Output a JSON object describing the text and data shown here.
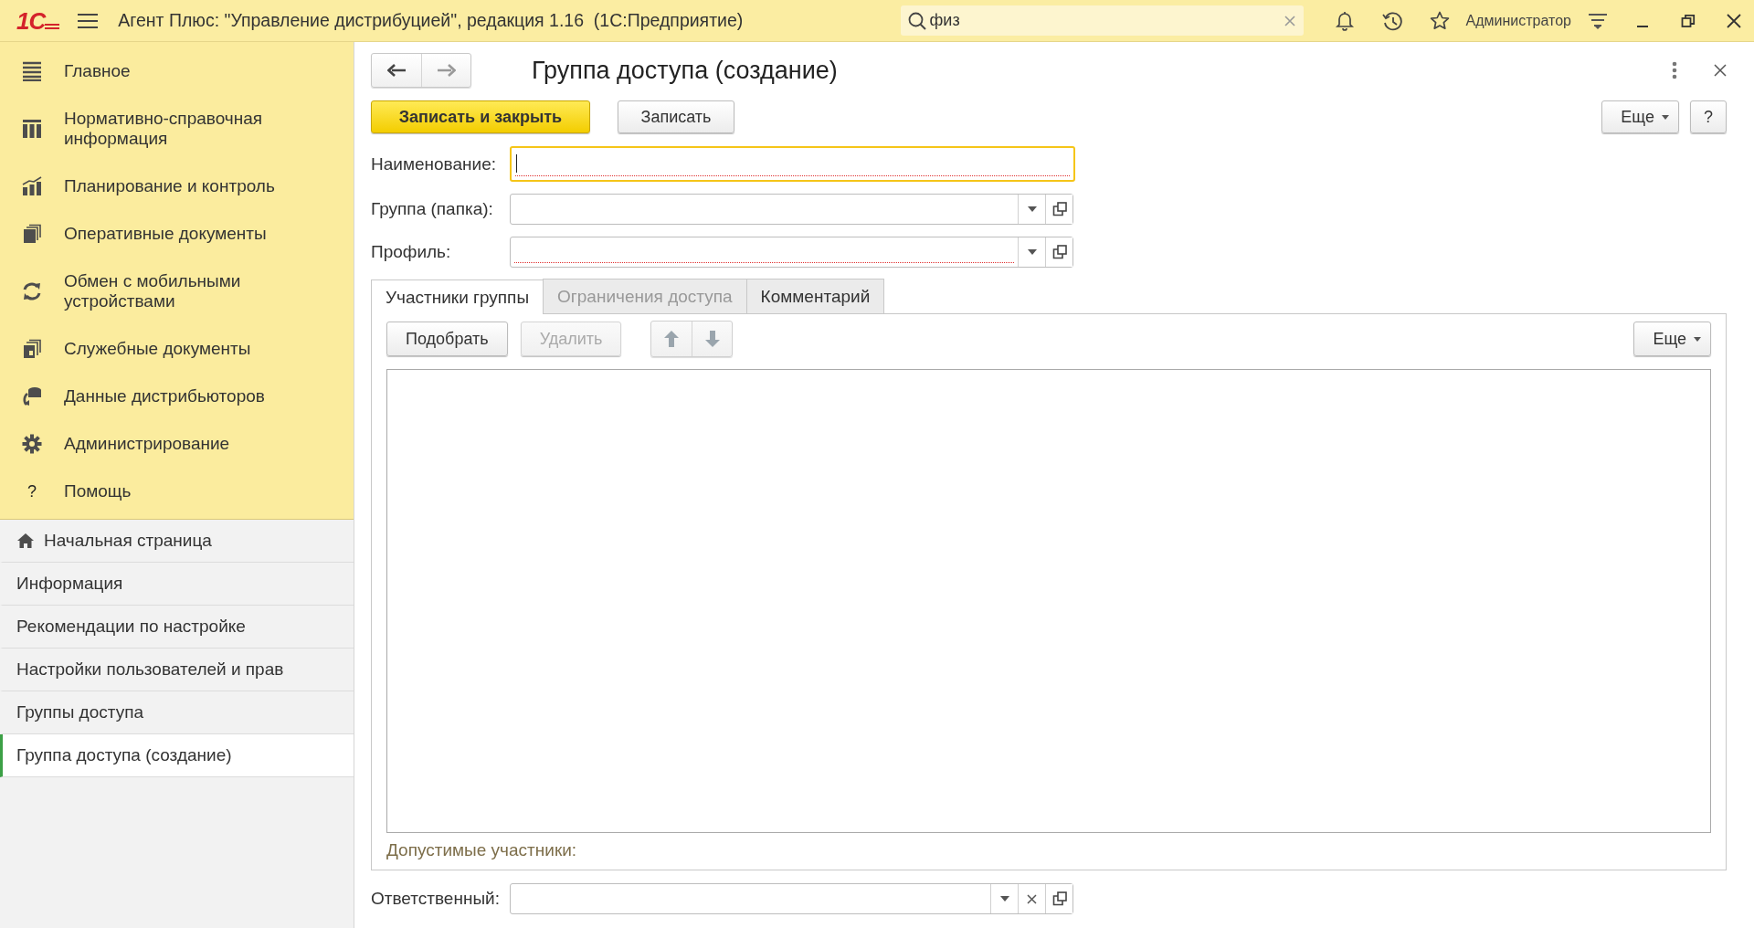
{
  "app": {
    "logo": "1С",
    "title": "Агент Плюс: \"Управление дистрибуцией\", редакция 1.16  (1С:Предприятие)",
    "search": {
      "value": "физ"
    },
    "user": "Администратор"
  },
  "sections": [
    {
      "label": "Главное",
      "kind": "list"
    },
    {
      "label": "Нормативно-справочная информация",
      "kind": "catalog"
    },
    {
      "label": "Планирование и контроль",
      "kind": "chart"
    },
    {
      "label": "Оперативные документы",
      "kind": "docs"
    },
    {
      "label": "Обмен с мобильными устройствами",
      "kind": "sync"
    },
    {
      "label": "Служебные документы",
      "kind": "docs2"
    },
    {
      "label": "Данные дистрибьюторов",
      "kind": "data"
    },
    {
      "label": "Администрирование",
      "kind": "gear"
    },
    {
      "label": "Помощь",
      "kind": "glyph",
      "glyph": "?"
    }
  ],
  "open_pages": [
    {
      "label": "Начальная страница",
      "kind": "home",
      "selected": false
    },
    {
      "label": "Информация",
      "kind": "page",
      "selected": false
    },
    {
      "label": "Рекомендации по настройке",
      "kind": "page",
      "selected": false
    },
    {
      "label": "Настройки пользователей и прав",
      "kind": "page",
      "selected": false
    },
    {
      "label": "Группы доступа",
      "kind": "page",
      "selected": false
    },
    {
      "label": "Группа доступа (создание)",
      "kind": "page",
      "selected": true
    }
  ],
  "form": {
    "title": "Группа доступа (создание)",
    "buttons": [
      {
        "label": "Записать и закрыть",
        "default": true
      },
      {
        "label": "Записать",
        "default": false
      }
    ],
    "more": "Еще",
    "help": "?",
    "fields": [
      {
        "label": "Наименование:",
        "kind": "text",
        "required": true,
        "focused": true
      },
      {
        "label": "Группа (папка):",
        "kind": "select",
        "required": false,
        "focused": false
      },
      {
        "label": "Профиль:",
        "kind": "select",
        "required": true,
        "focused": false
      }
    ],
    "tabs": [
      {
        "label": "Участники группы",
        "selected": true,
        "disabled": false
      },
      {
        "label": "Ограничения доступа",
        "selected": false,
        "disabled": true
      },
      {
        "label": "Комментарий",
        "selected": false,
        "disabled": false
      }
    ],
    "toolbar": {
      "buttons": [
        {
          "label": "Подобрать",
          "disabled": false
        },
        {
          "label": "Удалить",
          "disabled": true
        }
      ],
      "more": "Еще"
    },
    "note": "Допустимые участники:",
    "footer_fields": [
      {
        "label": "Ответственный:",
        "kind": "select_clear",
        "required": false,
        "focused": false
      }
    ]
  }
}
